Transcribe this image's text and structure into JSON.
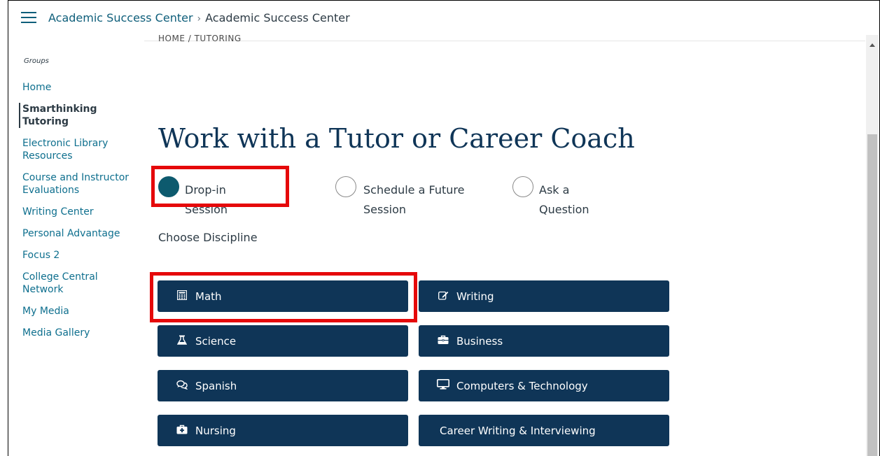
{
  "header": {
    "breadcrumb_link": "Academic Success Center",
    "breadcrumb_separator": "›",
    "breadcrumb_current": "Academic Success Center"
  },
  "sidebar": {
    "groups_label": "Groups",
    "items": [
      {
        "label": "Home",
        "active": false
      },
      {
        "label": "Smarthinking Tutoring",
        "active": true
      },
      {
        "label": "Electronic Library Resources",
        "active": false
      },
      {
        "label": "Course and Instructor Evaluations",
        "active": false
      },
      {
        "label": "Writing Center",
        "active": false
      },
      {
        "label": "Personal Advantage",
        "active": false
      },
      {
        "label": "Focus 2",
        "active": false
      },
      {
        "label": "College Central Network",
        "active": false
      },
      {
        "label": "My Media",
        "active": false
      },
      {
        "label": "Media Gallery",
        "active": false
      }
    ]
  },
  "main": {
    "page_breadcrumb": "HOME / TUTORING",
    "title": "Work with a Tutor or Career Coach",
    "session_options": [
      {
        "label": "Drop-in Session",
        "checked": true
      },
      {
        "label": "Schedule a Future Session",
        "checked": false
      },
      {
        "label": "Ask a Question",
        "checked": false
      }
    ],
    "discipline_label": "Choose Discipline",
    "disciplines": [
      {
        "label": "Math",
        "icon": "calculator-icon"
      },
      {
        "label": "Writing",
        "icon": "edit-icon"
      },
      {
        "label": "Science",
        "icon": "flask-icon"
      },
      {
        "label": "Business",
        "icon": "briefcase-icon"
      },
      {
        "label": "Spanish",
        "icon": "speech-bubbles-icon"
      },
      {
        "label": "Computers & Technology",
        "icon": "monitor-icon"
      },
      {
        "label": "Nursing",
        "icon": "medical-kit-icon"
      },
      {
        "label": "Career Writing & Interviewing",
        "icon": ""
      }
    ]
  },
  "colors": {
    "accent_dark": "#0f3557",
    "link": "#0e6f8e",
    "radio_checked": "#0d5a6e",
    "highlight": "#e5080a"
  }
}
